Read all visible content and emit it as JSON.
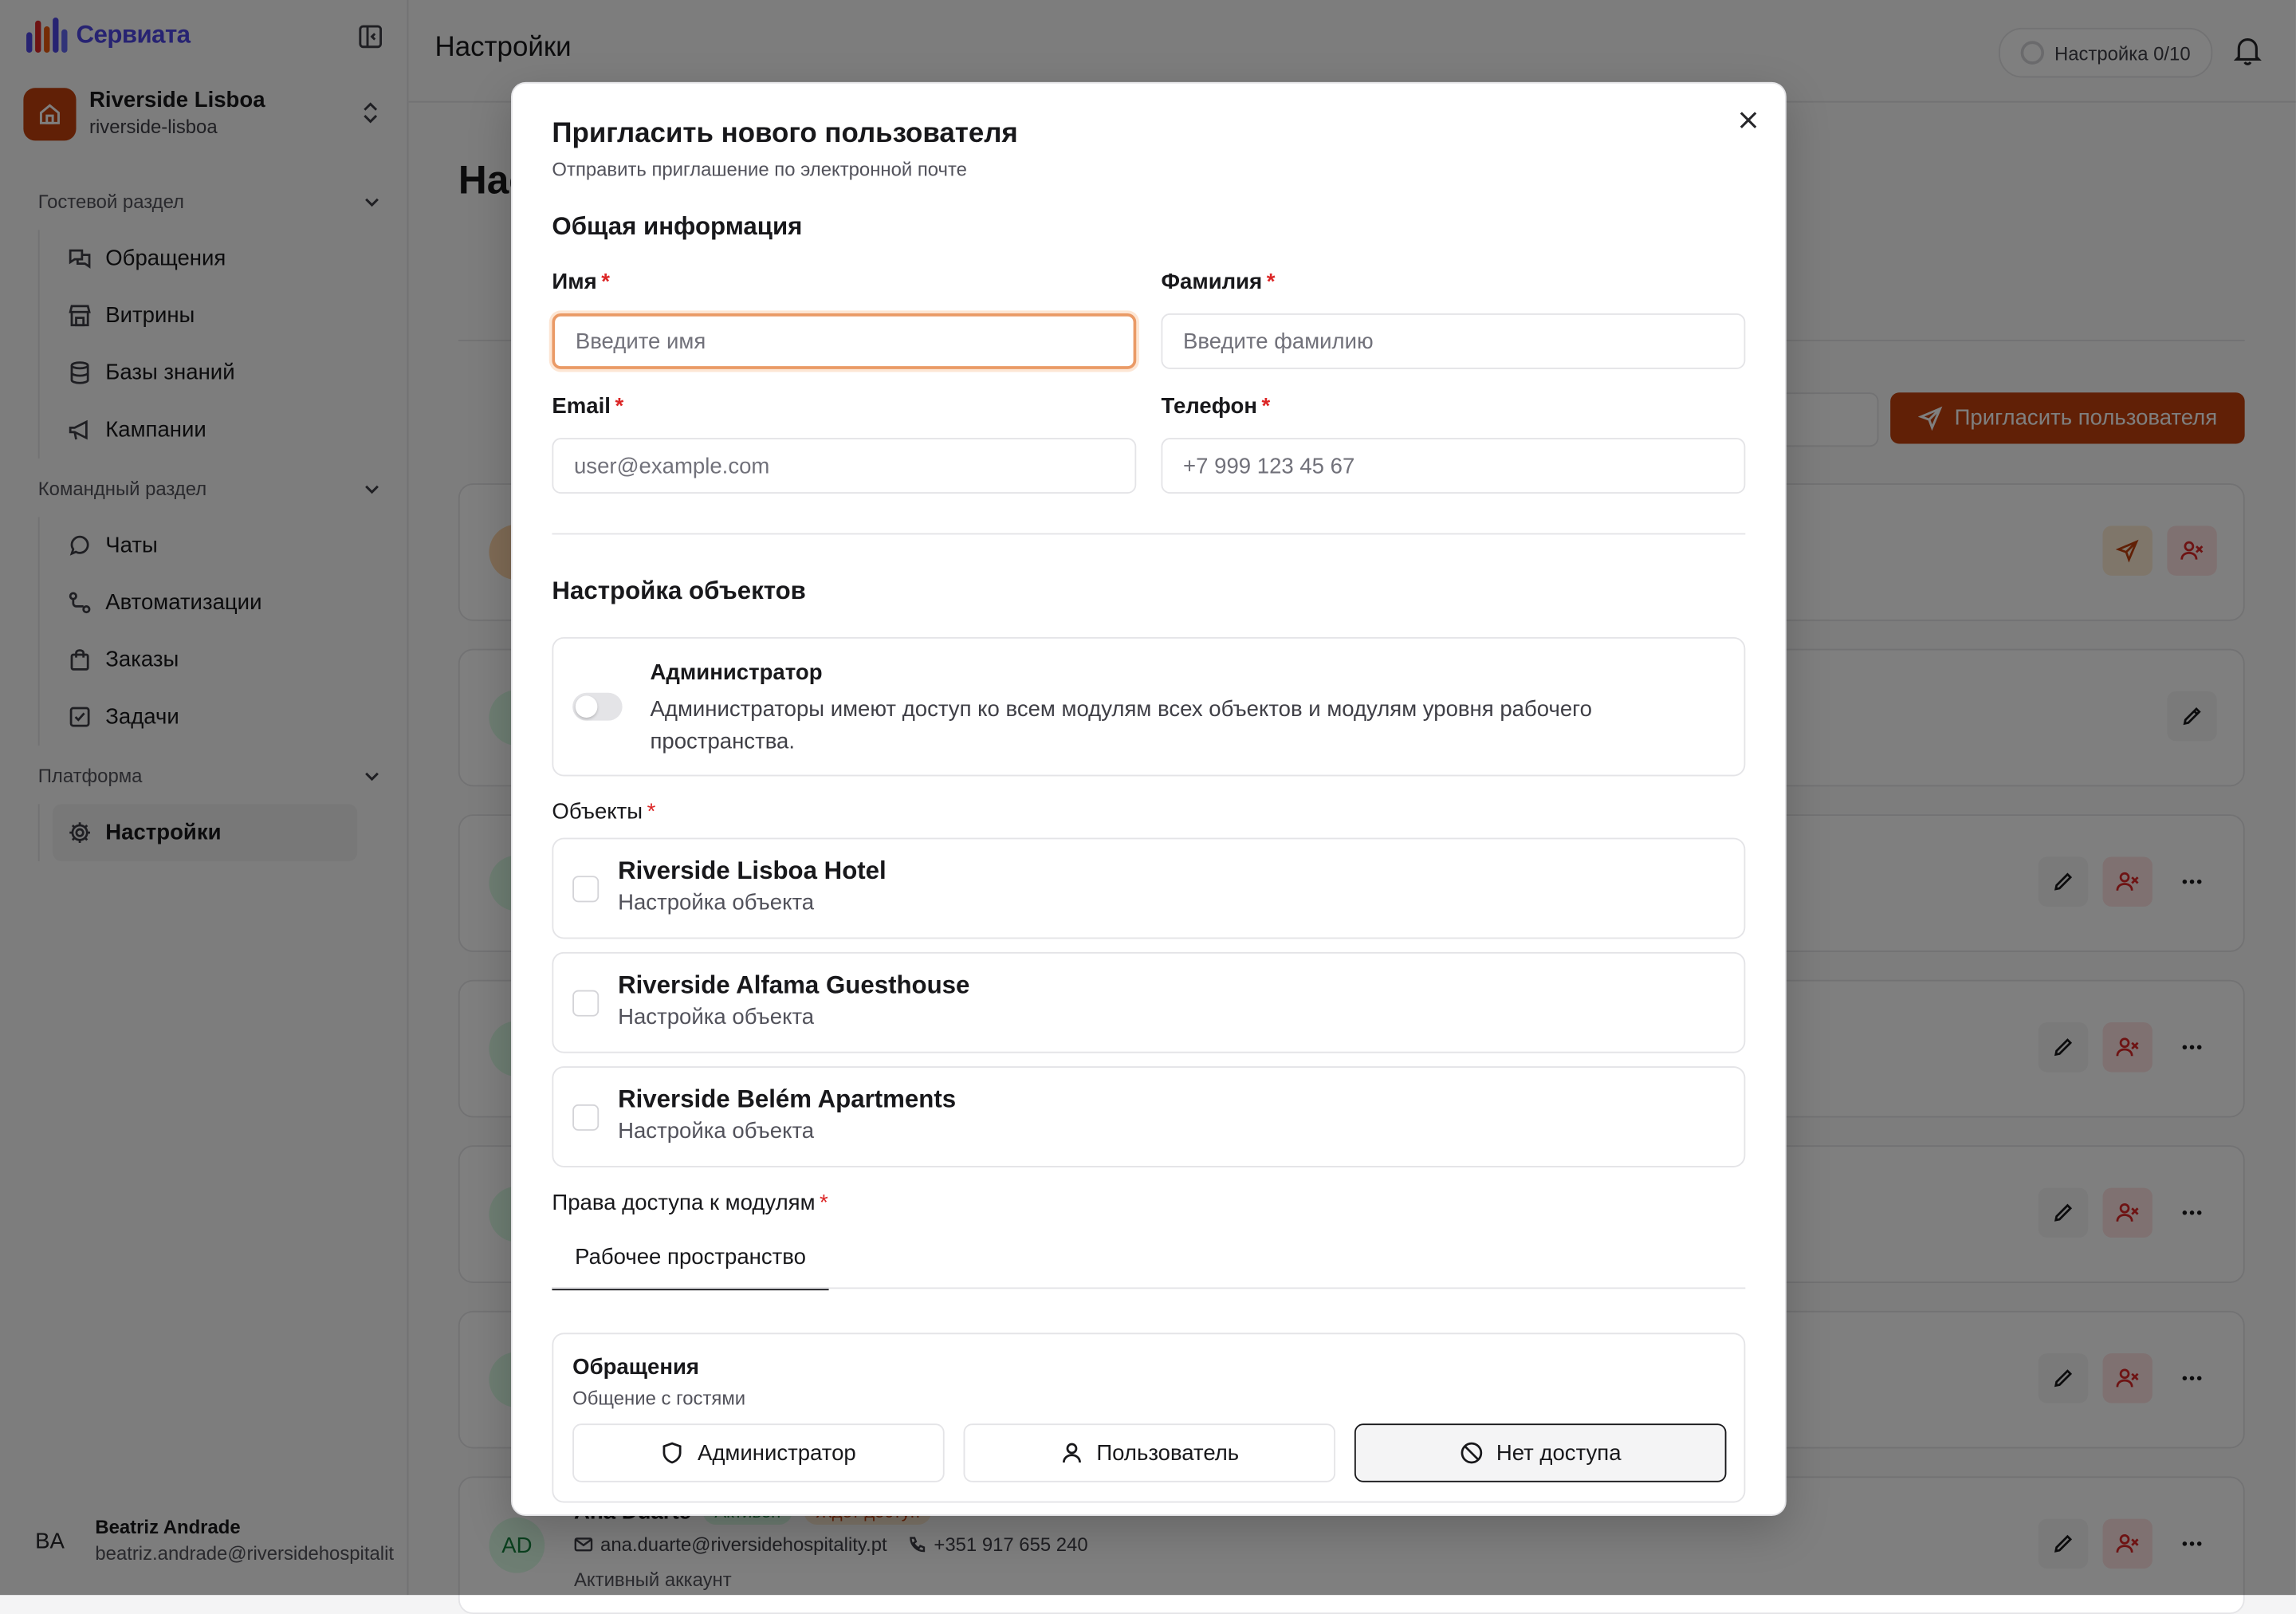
{
  "brand": {
    "name": "Сервиата"
  },
  "workspace": {
    "name": "Riverside Lisboa",
    "slug": "riverside-lisboa"
  },
  "sidebar": {
    "sections": [
      {
        "title": "Гостевой раздел",
        "items": [
          "Обращения",
          "Витрины",
          "Базы знаний",
          "Кампании"
        ]
      },
      {
        "title": "Командный раздел",
        "items": [
          "Чаты",
          "Автоматизации",
          "Заказы",
          "Задачи"
        ]
      },
      {
        "title": "Платформа",
        "items": [
          "Настройки"
        ]
      }
    ]
  },
  "user": {
    "initials": "BA",
    "name": "Beatriz Andrade",
    "email": "beatriz.andrade@riversidehospitality.pt"
  },
  "header": {
    "title": "Настройки",
    "setup": "Настройка 0/10"
  },
  "background": {
    "invite_button": "Пригласить пользователя",
    "last_card": {
      "initials": "AD",
      "name": "Ana Duarte",
      "badge_active": "Активен",
      "badge_pending": "Ждет доступ",
      "email": "ana.duarte@riversidehospitality.pt",
      "phone": "+351 917 655 240",
      "status": "Активный аккаунт"
    }
  },
  "modal": {
    "title": "Пригласить нового пользователя",
    "subtitle": "Отправить приглашение по электронной почте",
    "general_section": "Общая информация",
    "first_name": {
      "label": "Имя",
      "placeholder": "Введите имя"
    },
    "last_name": {
      "label": "Фамилия",
      "placeholder": "Введите фамилию"
    },
    "email": {
      "label": "Email",
      "placeholder": "user@example.com"
    },
    "phone": {
      "label": "Телефон",
      "placeholder": "+7 999 123 45 67"
    },
    "objects_section": "Настройка объектов",
    "admin": {
      "title": "Администратор",
      "description": "Администраторы имеют доступ ко всем модулям всех объектов и модулям уровня рабочего пространства."
    },
    "objects_label": "Объекты",
    "objects": [
      {
        "name": "Riverside Lisboa Hotel",
        "sub": "Настройка объекта"
      },
      {
        "name": "Riverside Alfama Guesthouse",
        "sub": "Настройка объекта"
      },
      {
        "name": "Riverside Belém Apartments",
        "sub": "Настройка объекта"
      }
    ],
    "modules_label": "Права доступа к модулям",
    "modules_tab": "Рабочее пространство",
    "module": {
      "title": "Обращения",
      "subtitle": "Общение с гостями",
      "options": [
        "Администратор",
        "Пользователь",
        "Нет доступа"
      ],
      "selected": "Нет доступа"
    }
  }
}
